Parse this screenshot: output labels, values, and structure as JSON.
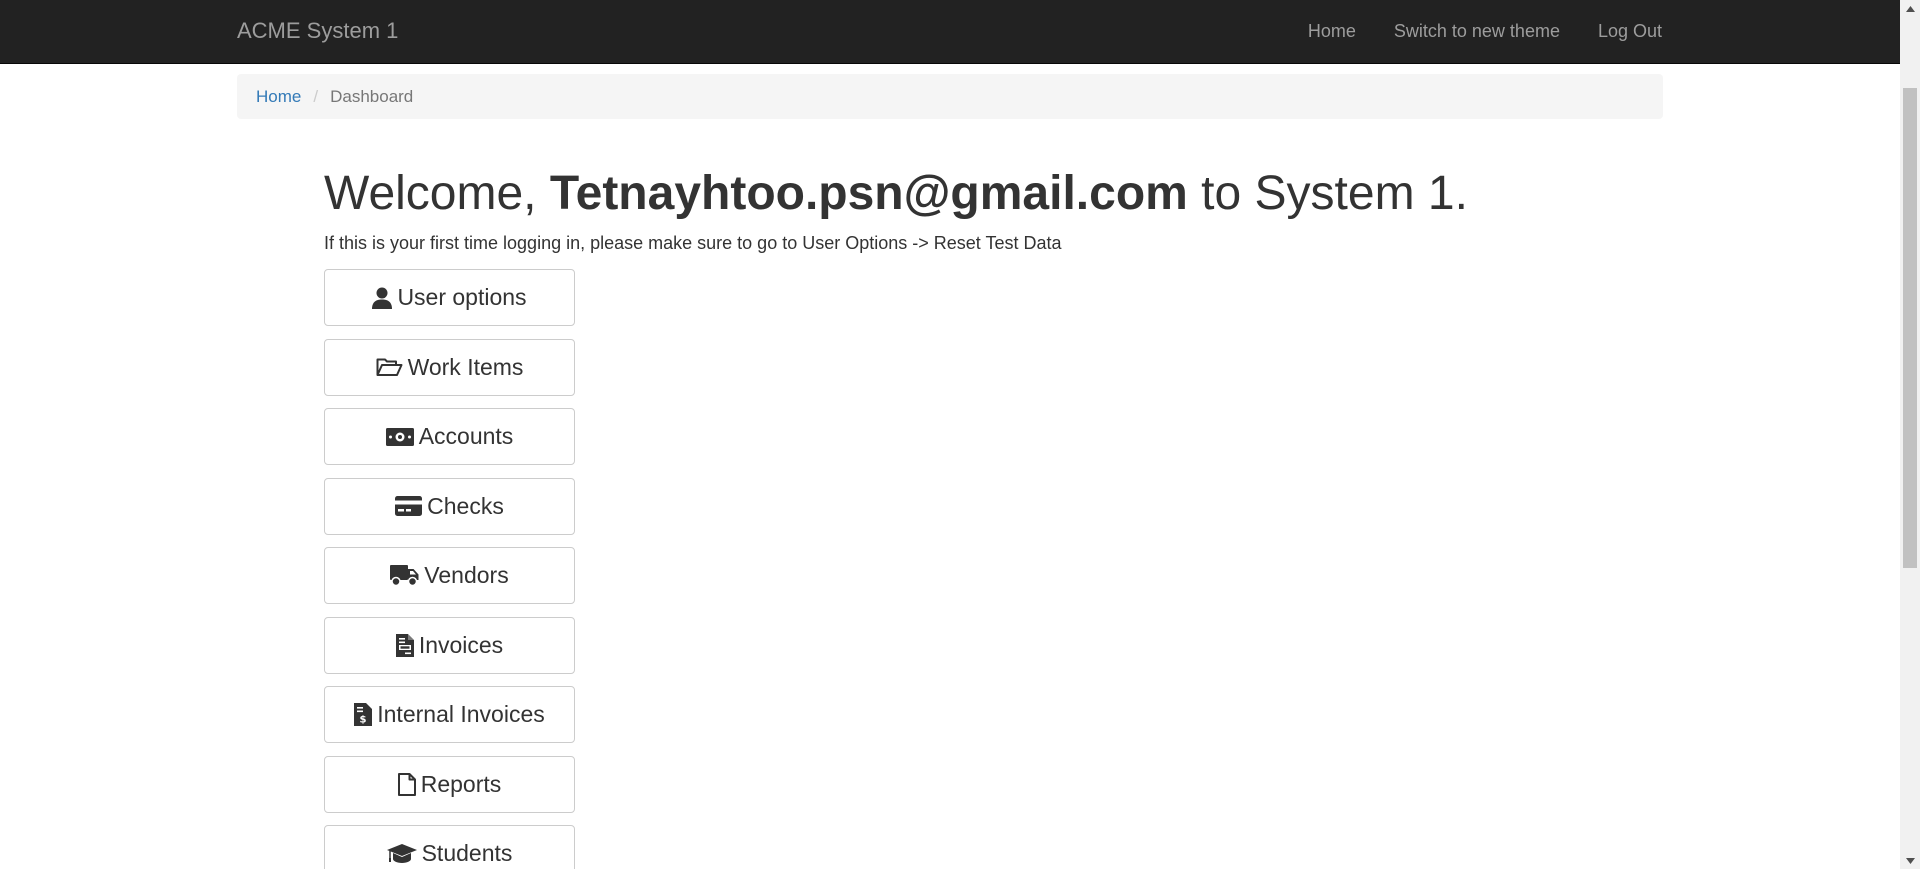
{
  "navbar": {
    "brand": "ACME System 1",
    "links": [
      "Home",
      "Switch to new theme",
      "Log Out"
    ]
  },
  "breadcrumb": {
    "home": "Home",
    "separator": "/",
    "current": "Dashboard"
  },
  "welcome": {
    "prefix": "Welcome,",
    "user": "Tetnayhtoo.psn@gmail.com",
    "suffix": "to System 1."
  },
  "hint": "If this is your first time logging in, please make sure to go to User Options -> Reset Test Data",
  "menu": [
    {
      "label": "User options",
      "icon": "user-icon"
    },
    {
      "label": "Work Items",
      "icon": "folder-open-icon"
    },
    {
      "label": "Accounts",
      "icon": "money-bill-icon"
    },
    {
      "label": "Checks",
      "icon": "credit-card-icon"
    },
    {
      "label": "Vendors",
      "icon": "truck-icon"
    },
    {
      "label": "Invoices",
      "icon": "invoice-icon"
    },
    {
      "label": "Internal Invoices",
      "icon": "invoice-dollar-icon"
    },
    {
      "label": "Reports",
      "icon": "file-icon"
    },
    {
      "label": "Students",
      "icon": "graduation-cap-icon"
    }
  ],
  "colors": {
    "navbar_bg": "#222222",
    "navbar_text": "#9d9d9d",
    "link": "#337ab7",
    "breadcrumb_bg": "#f5f5f5",
    "text": "#333333"
  }
}
